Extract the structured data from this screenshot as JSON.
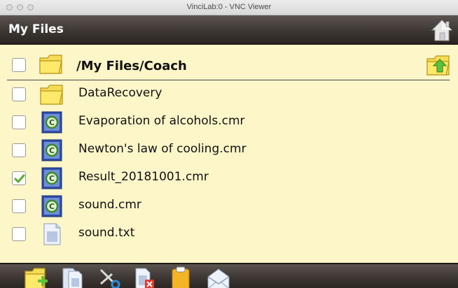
{
  "window": {
    "title": "VinciLab:0 - VNC Viewer"
  },
  "header": {
    "title": "My Files",
    "home_icon": "home-icon"
  },
  "path": {
    "text": "/My Files/Coach",
    "checked": false,
    "folder_icon": "folder-icon",
    "up_icon": "folder-up-icon"
  },
  "files": [
    {
      "name": "DataRecovery",
      "icon": "folder-icon",
      "checked": false
    },
    {
      "name": "Evaporation of alcohols.cmr",
      "icon": "coach-document-icon",
      "checked": false
    },
    {
      "name": "Newton's law of cooling.cmr",
      "icon": "coach-document-icon",
      "checked": false
    },
    {
      "name": "Result_20181001.cmr",
      "icon": "coach-document-icon",
      "checked": true
    },
    {
      "name": "sound.cmr",
      "icon": "coach-document-icon",
      "checked": false
    },
    {
      "name": "sound.txt",
      "icon": "text-file-icon",
      "checked": false
    }
  ],
  "toolbar": {
    "buttons": [
      "new-folder-icon",
      "copy-icon",
      "cut-icon",
      "delete-file-icon",
      "paste-icon",
      "email-icon"
    ]
  },
  "colors": {
    "list_background": "#fdf6c8",
    "bar_dark": "#3e3834",
    "check_green": "#5aaa2a"
  }
}
